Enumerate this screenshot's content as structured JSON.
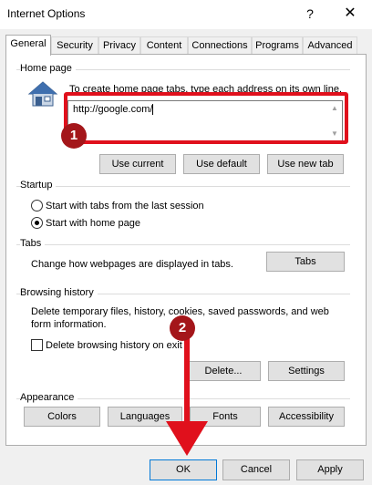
{
  "window": {
    "title": "Internet Options",
    "help_glyph": "?",
    "close_glyph": "✕"
  },
  "tabs": [
    {
      "label": "General",
      "active": true
    },
    {
      "label": "Security"
    },
    {
      "label": "Privacy"
    },
    {
      "label": "Content"
    },
    {
      "label": "Connections"
    },
    {
      "label": "Programs"
    },
    {
      "label": "Advanced"
    }
  ],
  "home_page": {
    "section_label": "Home page",
    "instruction": "To create home page tabs, type each address on its own line.",
    "url_value": "http://google.com/",
    "buttons": {
      "use_current": "Use current",
      "use_default": "Use default",
      "use_new_tab": "Use new tab"
    }
  },
  "startup": {
    "section_label": "Startup",
    "options": [
      {
        "label": "Start with tabs from the last session",
        "checked": false
      },
      {
        "label": "Start with home page",
        "checked": true
      }
    ]
  },
  "tabs_section": {
    "section_label": "Tabs",
    "description": "Change how webpages are displayed in tabs.",
    "button": "Tabs"
  },
  "browsing_history": {
    "section_label": "Browsing history",
    "description": "Delete temporary files, history, cookies, saved passwords, and web form information.",
    "checkbox_label": "Delete browsing history on exit",
    "checkbox_checked": false,
    "delete_button": "Delete...",
    "settings_button": "Settings"
  },
  "appearance": {
    "section_label": "Appearance",
    "buttons": [
      "Colors",
      "Languages",
      "Fonts",
      "Accessibility"
    ]
  },
  "footer": {
    "ok": "OK",
    "cancel": "Cancel",
    "apply": "Apply"
  },
  "annotations": {
    "badge_1": "1",
    "badge_2": "2",
    "color": "#e0101c"
  }
}
